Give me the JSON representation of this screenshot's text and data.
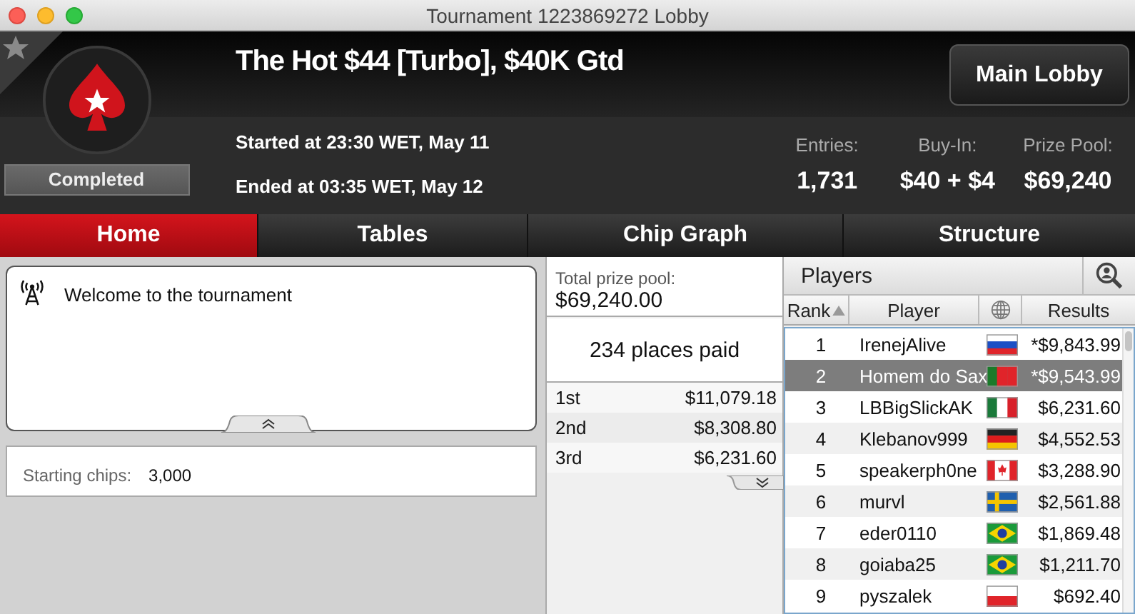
{
  "window": {
    "title": "Tournament 1223869272 Lobby"
  },
  "header": {
    "favorite": false,
    "status": "Completed",
    "title": "The Hot $44 [Turbo], $40K Gtd",
    "started": "Started at 23:30 WET, May 11",
    "ended": "Ended at 03:35 WET, May 12",
    "main_lobby_button": "Main Lobby",
    "stats": [
      {
        "label": "Entries:",
        "value": "1,731"
      },
      {
        "label": "Buy-In:",
        "value": "$40 + $4"
      },
      {
        "label": "Prize Pool:",
        "value": "$69,240"
      }
    ]
  },
  "tabs": [
    {
      "label": "Home",
      "selected": true
    },
    {
      "label": "Tables",
      "selected": false
    },
    {
      "label": "Chip Graph",
      "selected": false
    },
    {
      "label": "Structure",
      "selected": false
    }
  ],
  "news": {
    "message": "Welcome to the tournament"
  },
  "info": {
    "label": "Starting chips:",
    "value": "3,000"
  },
  "prizes": {
    "total_label": "Total prize pool:",
    "total": "$69,240.00",
    "places_paid": "234 places paid",
    "rows": [
      {
        "place": "1st",
        "amount": "$11,079.18"
      },
      {
        "place": "2nd",
        "amount": "$8,308.80"
      },
      {
        "place": "3rd",
        "amount": "$6,231.60"
      }
    ]
  },
  "players": {
    "title": "Players",
    "columns": [
      "Rank",
      "Player",
      "Results"
    ],
    "rows": [
      {
        "rank": "1",
        "name": "IrenejAlive",
        "result": "*$9,843.99",
        "selected": false
      },
      {
        "rank": "2",
        "name": "Homem do Sax",
        "result": "*$9,543.99",
        "selected": true
      },
      {
        "rank": "3",
        "name": "LBBigSlickAK",
        "result": "$6,231.60",
        "selected": false
      },
      {
        "rank": "4",
        "name": "Klebanov999",
        "result": "$4,552.53",
        "selected": false
      },
      {
        "rank": "5",
        "name": "speakerph0ne",
        "result": "$3,288.90",
        "selected": false
      },
      {
        "rank": "6",
        "name": "murvl",
        "result": "$2,561.88",
        "selected": false
      },
      {
        "rank": "7",
        "name": "eder0110",
        "result": "$1,869.48",
        "selected": false
      },
      {
        "rank": "8",
        "name": "goiaba25",
        "result": "$1,211.70",
        "selected": false
      },
      {
        "rank": "9",
        "name": "pyszalek",
        "result": "$692.40",
        "selected": false
      }
    ]
  }
}
